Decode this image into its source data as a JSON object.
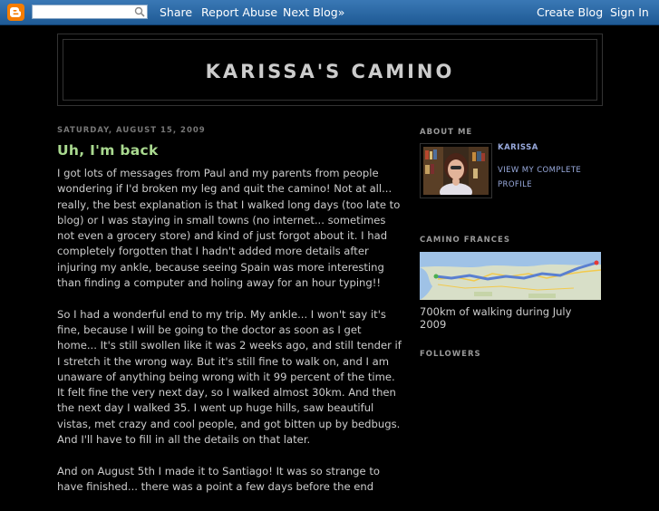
{
  "navbar": {
    "search_placeholder": "",
    "share": "Share",
    "report_abuse": "Report Abuse",
    "next_blog": "Next Blog»",
    "create_blog": "Create Blog",
    "sign_in": "Sign In"
  },
  "header": {
    "title": "KARISSA'S CAMINO"
  },
  "post": {
    "date": "SATURDAY, AUGUST 15, 2009",
    "title": "Uh, I'm back",
    "paragraphs": [
      "I got lots of messages from Paul and my parents from people wondering if I'd broken my leg and quit the camino! Not at all... really, the best explanation is that I walked long days (too late to blog) or I was staying in small towns (no internet... sometimes not even a grocery store) and kind of just forgot about it. I had completely forgotten that I hadn't added more details after injuring my ankle, because seeing Spain was more interesting than finding a computer and holing away for an hour typing!!",
      "So I had a wonderful end to my trip. My ankle... I won't say it's fine, because I will be going to the doctor as soon as I get home... It's still swollen like it was 2 weeks ago, and still tender if I stretch it the wrong way. But it's still fine to walk on, and I am unaware of anything being wrong with it 99 percent of the time. It felt fine the very next day, so I walked almost 30km. And then the next day I walked 35. I went up huge hills, saw beautiful vistas, met crazy and cool people, and got bitten up by bedbugs. And I'll have to fill in all the details on that later.",
      "And on August 5th I made it to Santiago! It was so strange to have finished... there was a point a few days before the end"
    ]
  },
  "sidebar": {
    "about_heading": "ABOUT ME",
    "profile_name": "KARISSA",
    "profile_link": "VIEW MY COMPLETE PROFILE",
    "map_heading": "CAMINO FRANCES",
    "map_caption": "700km of walking during July 2009",
    "followers_heading": "FOLLOWERS"
  },
  "colors": {
    "navbar": "#2b6aa8",
    "post_title": "#a9d98f",
    "link": "#99aadd",
    "background": "#000000"
  }
}
